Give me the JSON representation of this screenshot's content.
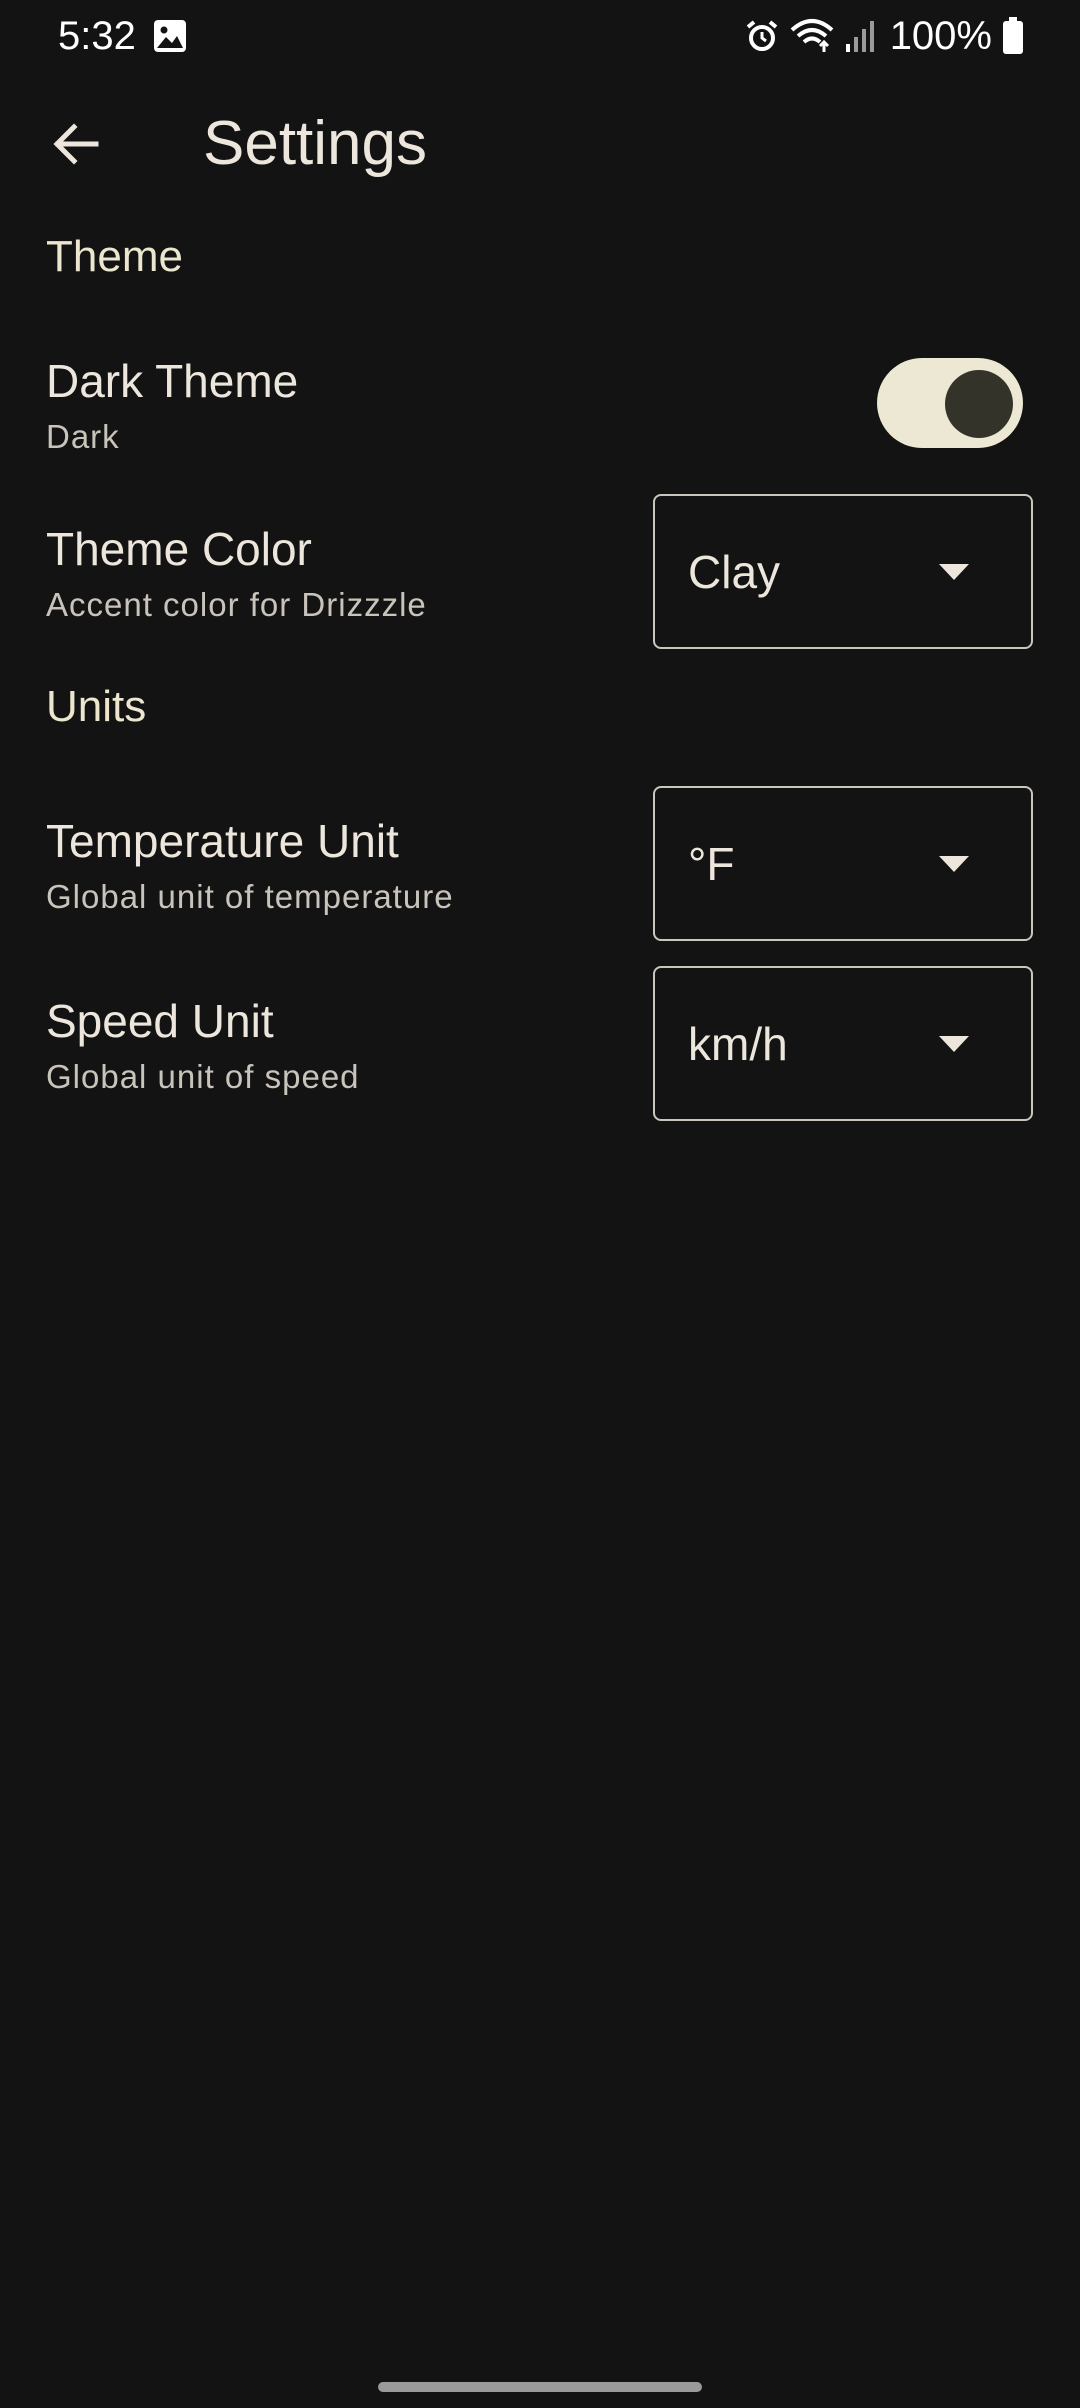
{
  "status_bar": {
    "time": "5:32",
    "battery": "100%",
    "icons": [
      "gallery-icon",
      "alarm-icon",
      "wifi-icon",
      "signal-icon",
      "battery-icon"
    ]
  },
  "app_bar": {
    "title": "Settings",
    "back_icon": "arrow-back-icon"
  },
  "sections": {
    "theme": {
      "header": "Theme",
      "dark_theme": {
        "title": "Dark Theme",
        "subtitle": "Dark",
        "enabled": true
      },
      "theme_color": {
        "title": "Theme Color",
        "subtitle": "Accent color for Drizzzle",
        "value": "Clay"
      }
    },
    "units": {
      "header": "Units",
      "temperature": {
        "title": "Temperature Unit",
        "subtitle": "Global unit of temperature",
        "value": "°F"
      },
      "speed": {
        "title": "Speed Unit",
        "subtitle": "Global unit of speed",
        "value": "km/h"
      }
    }
  },
  "colors": {
    "background": "#141313",
    "text": "#ece6dc",
    "accent": "#ede8d4",
    "outline": "#cac5bd"
  }
}
